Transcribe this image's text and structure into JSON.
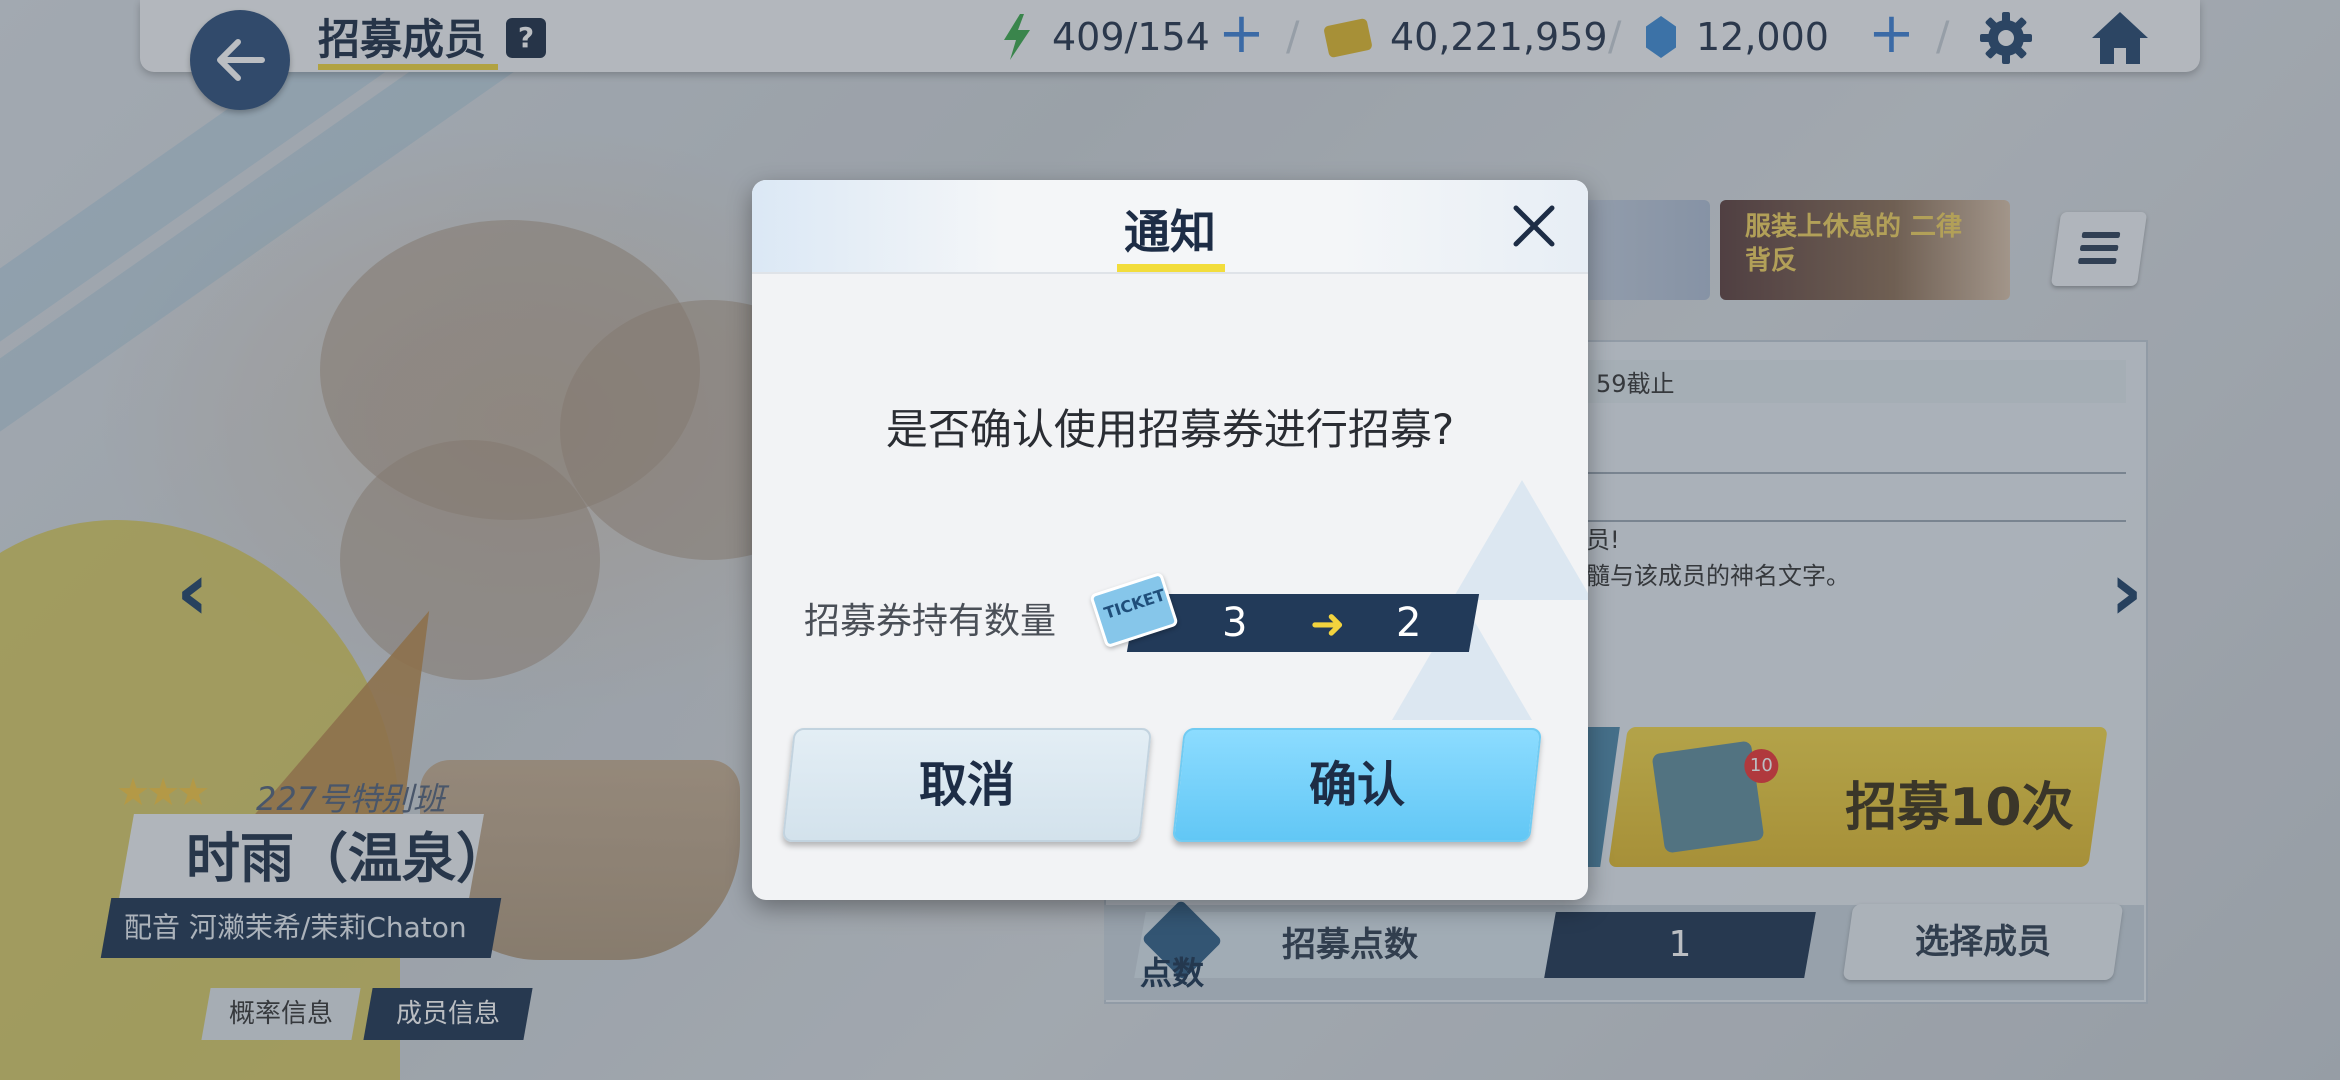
{
  "header": {
    "title": "招募成员",
    "help_icon": "?",
    "stamina": "409/154",
    "credits": "40,221,959",
    "gems": "12,000",
    "separator": "/",
    "plus": "+"
  },
  "banner": {
    "thumb_text": "服装上休息的 二律背反",
    "deadline_partial": "59截止",
    "desc_line1": "员!",
    "desc_line2": "髓与该成员的神名文字。"
  },
  "character": {
    "squad": "227号特别班",
    "name": "时雨（温泉）",
    "voice": "配音 河濑茉希/茉莉Chaton",
    "stars": "★★★",
    "rate_info_label": "概率信息",
    "member_info_label": "成员信息"
  },
  "recruit": {
    "ten_label": "招募10次",
    "ten_badge": "10",
    "points_label": "招募点数",
    "points_value": "1",
    "points_icon_text": "点数",
    "select_member_label": "选择成员"
  },
  "dialog": {
    "title": "通知",
    "question": "是否确认使用招募券进行招募?",
    "ticket_label": "招募券持有数量",
    "ticket_icon_text": "TICKET",
    "ticket_from": "3",
    "ticket_arrow": "➜",
    "ticket_to": "2",
    "cancel_label": "取消",
    "confirm_label": "确认"
  },
  "nav": {
    "left": "‹",
    "right": "›"
  },
  "colors": {
    "accent_yellow": "#f2dd3c",
    "navy": "#1d3350",
    "confirm_blue": "#62c7f5",
    "plus_blue": "#3b7fd4"
  },
  "icons": [
    "back-arrow-icon",
    "help-icon",
    "lightning-icon",
    "credit-card-icon",
    "gem-icon",
    "gear-icon",
    "home-icon",
    "close-icon",
    "ticket-icon",
    "envelope-icon",
    "menu-icon",
    "chevron-left-icon",
    "chevron-right-icon",
    "star-icon"
  ]
}
